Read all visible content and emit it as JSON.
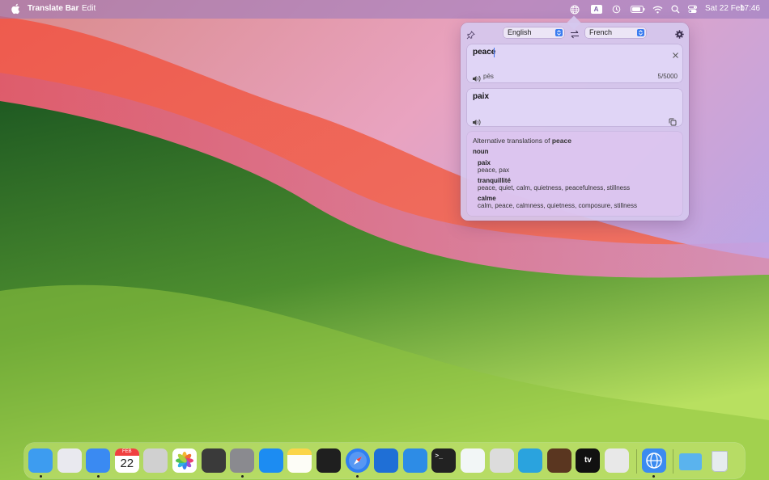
{
  "menubar": {
    "app_name": "Translate Bar",
    "menu_items": [
      "Edit"
    ],
    "status_icons": [
      "globe-icon",
      "input-source-icon",
      "time-machine-icon",
      "battery-icon",
      "wifi-icon",
      "search-icon",
      "control-center-icon"
    ],
    "input_source": "A",
    "date": "Sat 22 Feb",
    "time": "17:46"
  },
  "popover": {
    "source_language": "English",
    "target_language": "French",
    "source_text": "peace",
    "pronunciation": "pēs",
    "char_count": "5/5000",
    "translation": "paix",
    "alternatives": {
      "heading_prefix": "Alternative translations of",
      "heading_word": "peace",
      "part_of_speech": "noun",
      "entries": [
        {
          "word": "paix",
          "synonyms": "peace, pax"
        },
        {
          "word": "tranquillité",
          "synonyms": "peace, quiet, calm, quietness, peacefulness, stillness"
        },
        {
          "word": "calme",
          "synonyms": "calm, peace, calmness, quietness, composure, stillness"
        }
      ]
    }
  },
  "dock": {
    "calendar_month": "FEB",
    "calendar_day": "22",
    "apple_tv_label": "tv",
    "apps": [
      {
        "name": "finder-icon",
        "color": "#3d9cf0",
        "running": true
      },
      {
        "name": "launchpad-icon",
        "color": "#e9e9ef",
        "running": false
      },
      {
        "name": "mail-icon",
        "color": "#3a8af2",
        "running": true
      },
      {
        "name": "calendar-icon",
        "color": "#ffffff",
        "running": false
      },
      {
        "name": "calculator-icon",
        "color": "#d0d0d0",
        "running": false
      },
      {
        "name": "photos-icon",
        "color": "#ffffff",
        "running": false
      },
      {
        "name": "sublime-text-icon",
        "color": "#3a3a3a",
        "running": false
      },
      {
        "name": "system-settings-icon",
        "color": "#8a8a8f",
        "running": true
      },
      {
        "name": "app-store-icon",
        "color": "#1c8cf2",
        "running": false
      },
      {
        "name": "notes-icon",
        "color": "#fbd54a",
        "running": false
      },
      {
        "name": "activity-monitor-icon",
        "color": "#1f1f1f",
        "running": false
      },
      {
        "name": "safari-icon",
        "color": "#2f7ff1",
        "running": true
      },
      {
        "name": "xcode-icon",
        "color": "#1f6fd6",
        "running": false
      },
      {
        "name": "fork-icon",
        "color": "#2d8ce6",
        "running": false
      },
      {
        "name": "terminal-icon",
        "color": "#222222",
        "running": false
      },
      {
        "name": "surfshark-icon",
        "color": "#f2f6f6",
        "running": false
      },
      {
        "name": "disk-utility-icon",
        "color": "#dcdcdc",
        "running": false
      },
      {
        "name": "telegram-icon",
        "color": "#2aa3de",
        "running": false
      },
      {
        "name": "instruments-icon",
        "color": "#5a3620",
        "running": false
      },
      {
        "name": "apple-tv-icon",
        "color": "#111111",
        "running": false
      },
      {
        "name": "simulator-icon",
        "color": "#e8e8e8",
        "running": false
      },
      {
        "name": "translate-bar-icon",
        "color": "#3b8bf0",
        "running": true
      },
      {
        "name": "downloads-folder-icon",
        "color": "#5ab3ee",
        "running": false
      },
      {
        "name": "trash-icon",
        "color": "#dfe6ea",
        "running": false
      }
    ]
  }
}
